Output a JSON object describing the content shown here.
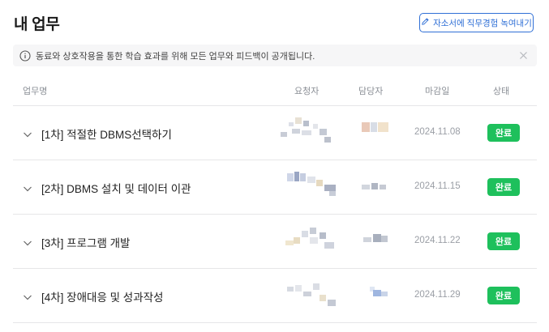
{
  "header": {
    "title": "내 업무",
    "record_button_label": "자소서에 직무경험 녹여내기"
  },
  "notice": {
    "text": "동료와 상호작용을 통한 학습 효과를 위해 모든 업무와 피드백이 공개됩니다."
  },
  "table": {
    "columns": {
      "name": "업무명",
      "requester": "요청자",
      "assignee": "담당자",
      "due_date": "마감일",
      "status": "상태"
    },
    "rows": [
      {
        "name": "[1차] 적절한 DBMS선택하기",
        "due_date": "2024.11.08",
        "status": "완료"
      },
      {
        "name": "[2차] DBMS 설치 및 데이터 이관",
        "due_date": "2024.11.15",
        "status": "완료"
      },
      {
        "name": "[3차] 프로그램 개발",
        "due_date": "2024.11.22",
        "status": "완료"
      },
      {
        "name": "[4차] 장애대응 및 성과작성",
        "due_date": "2024.11.29",
        "status": "완료"
      }
    ]
  },
  "colors": {
    "accent": "#2f6fd6",
    "status_done": "#1ec05c"
  },
  "icons": {
    "record": "pencil-icon",
    "notice": "info-icon",
    "close": "close-icon",
    "expand": "chevron-down-icon"
  }
}
